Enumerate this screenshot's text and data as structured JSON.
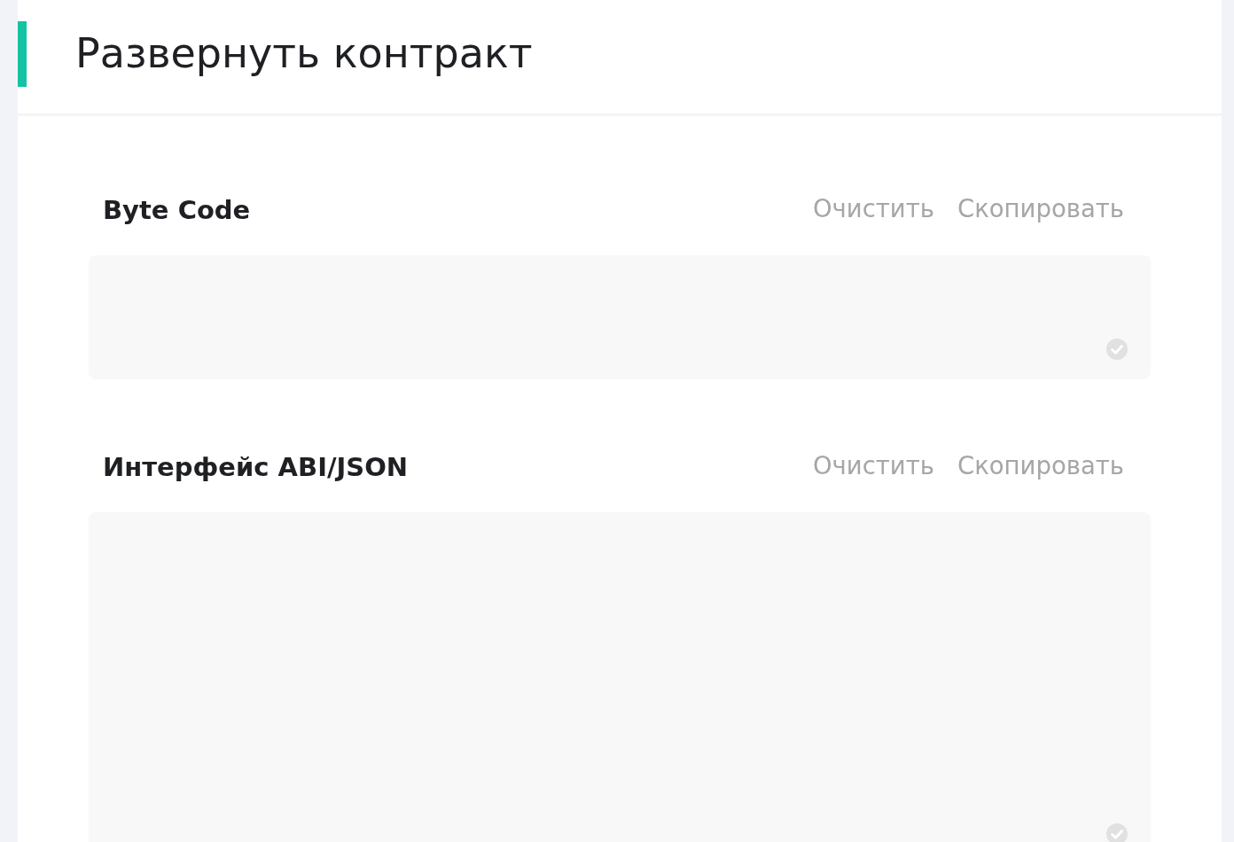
{
  "page": {
    "title": "Развернуть контракт"
  },
  "sections": [
    {
      "title": "Byte Code",
      "actions": [
        "Очистить",
        "Скопировать"
      ]
    },
    {
      "title": "Интерфейс ABI/JSON",
      "actions": [
        "Очистить",
        "Скопировать"
      ]
    }
  ]
}
